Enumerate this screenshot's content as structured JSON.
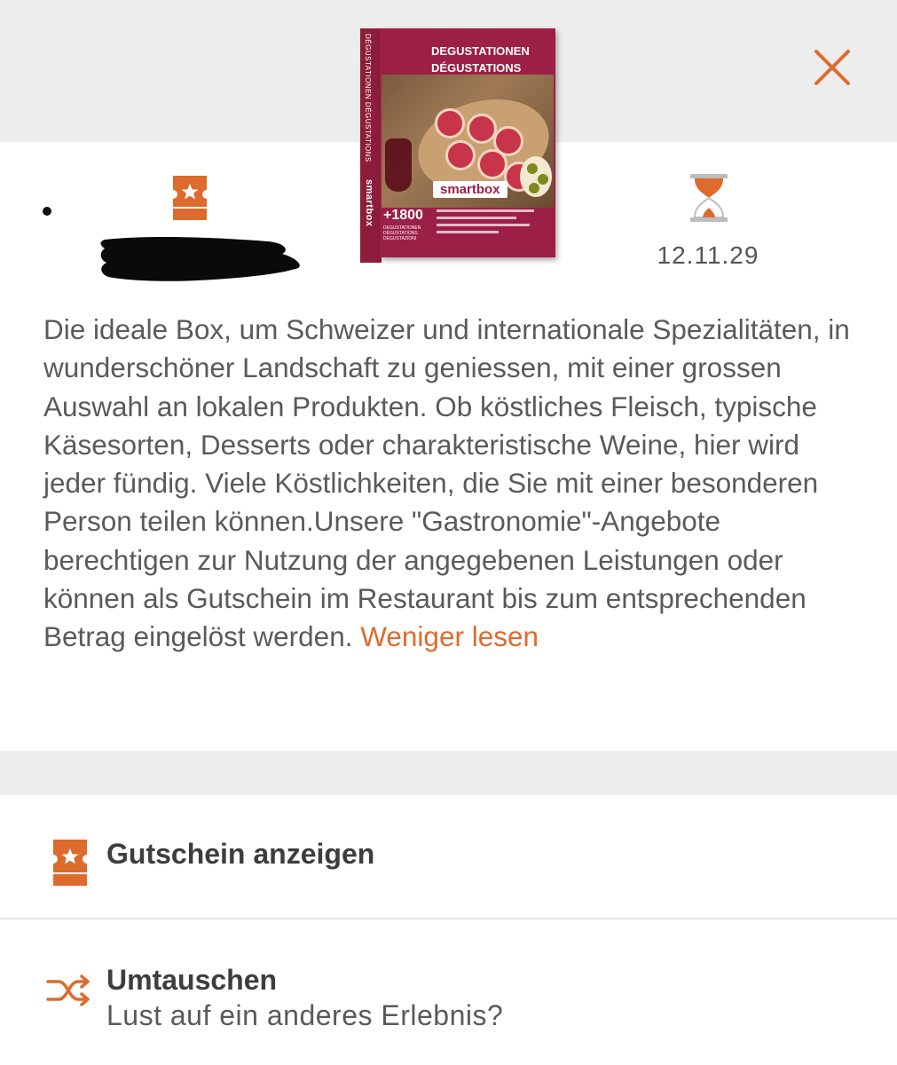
{
  "colors": {
    "accent": "#dd6b2d",
    "brand": "#9c1f45",
    "background_band": "#ededed"
  },
  "header": {
    "close_icon": "close-icon"
  },
  "product": {
    "title_line1": "DEGUSTATIONEN",
    "title_line2": "DÉGUSTATIONS",
    "spine_text": "DÉGUSTATIONEN DÉGUSTATIONS",
    "spine_brand": "smartbox",
    "brand": "smartbox",
    "count": "+1800",
    "count_sub": "DEGUSTATIONEN DÉGUSTATIONS DEGUSTAZIONI"
  },
  "voucher": {
    "icon": "voucher-icon",
    "expiry_icon": "hourglass-icon",
    "expiry_date": "12.11.29"
  },
  "description": {
    "text": "Die ideale Box, um Schweizer und internationale Spezialitäten, in wunderschöner Landschaft zu geniessen, mit einer grossen Auswahl an lokalen Produkten. Ob köstliches Fleisch, typische Käsesorten, Desserts oder charakteristische Weine, hier wird jeder fündig. Viele Köstlichkeiten, die Sie mit einer besonderen Person teilen können.Unsere \"Gastronomie\"-Angebote berechtigen zur Nutzung der angegebenen Leistungen oder können als Gutschein im Restaurant bis zum entsprechenden Betrag eingelöst werden.",
    "toggle_label": "Weniger lesen"
  },
  "actions": {
    "show_voucher": {
      "label": "Gutschein anzeigen",
      "icon": "voucher-icon"
    },
    "exchange": {
      "label": "Umtauschen",
      "sub": "Lust auf ein anderes Erlebnis?",
      "icon": "shuffle-icon"
    }
  }
}
